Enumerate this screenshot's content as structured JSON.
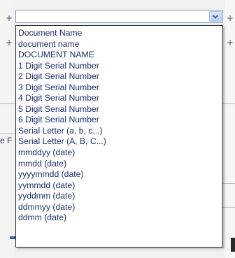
{
  "combo": {
    "value": "",
    "button_icon": "chevron-down-icon"
  },
  "background": {
    "plus_symbol": "+",
    "partial_label": "e F"
  },
  "dropdown": {
    "items": [
      {
        "label": "Document Name"
      },
      {
        "label": "document name"
      },
      {
        "label": "DOCUMENT NAME"
      },
      {
        "label": "1 Digit Serial Number"
      },
      {
        "label": "2 Digit Serial Number"
      },
      {
        "label": "3 Digit Serial Number"
      },
      {
        "label": "4 Digit Serial Number"
      },
      {
        "label": "5 Digit Serial Number"
      },
      {
        "label": "6 Digit Serial Number"
      },
      {
        "label": "Serial Letter (a, b, c...)"
      },
      {
        "label": "Serial Letter (A, B, C...)"
      },
      {
        "label": "mmddyy (date)"
      },
      {
        "label": "mmdd (date)"
      },
      {
        "label": "yyyymmdd (date)"
      },
      {
        "label": "yymmdd (date)"
      },
      {
        "label": "yyddmm (date)"
      },
      {
        "label": "ddmmyy (date)"
      },
      {
        "label": "ddmm (date)"
      }
    ]
  },
  "colors": {
    "list_text": "#1e2e6e",
    "combo_border": "#7e9db9",
    "list_border": "#2b2b2b"
  }
}
